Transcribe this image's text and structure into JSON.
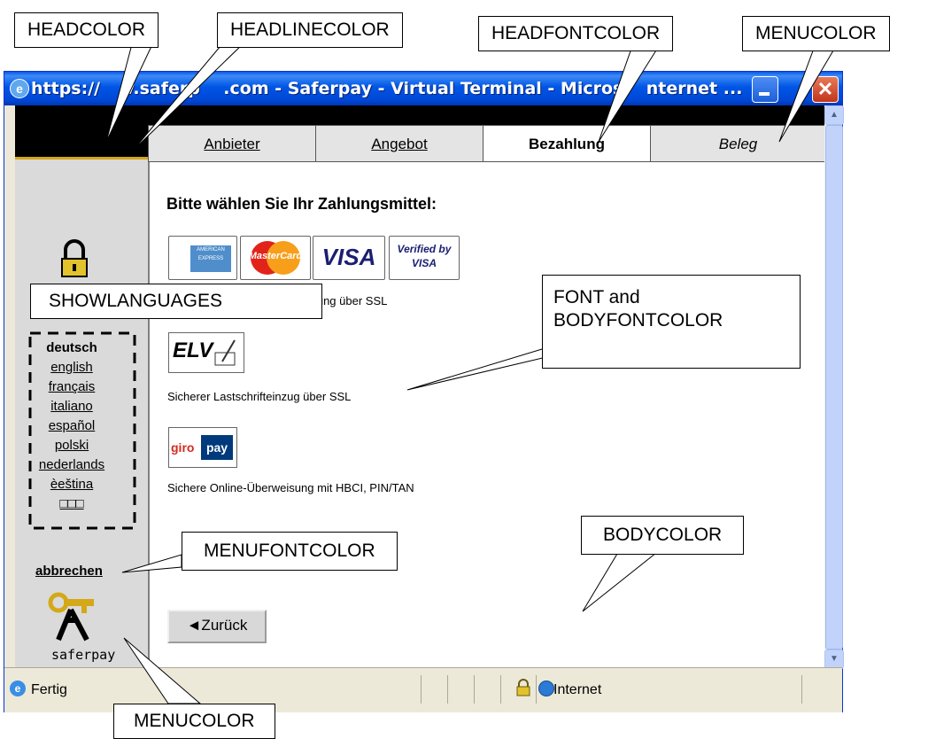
{
  "window": {
    "title": "https://www.saferpay.com - Saferpay - Virtual Terminal - Microsoft Internet ...",
    "title_visible": "https://    v.saferp    .com - Saferpay - Virtual Terminal - Micros    nternet ..."
  },
  "tabs": [
    {
      "label": "Anbieter",
      "state": "link"
    },
    {
      "label": "Angebot",
      "state": "link"
    },
    {
      "label": "Bezahlung",
      "state": "active"
    },
    {
      "label": "Beleg",
      "state": "disabled"
    }
  ],
  "content": {
    "heading": "Bitte wählen Sie Ihr Zahlungsmittel:",
    "card_logos": [
      "AMERICAN EXPRESS",
      "MasterCard",
      "VISA",
      "Verified by VISA"
    ],
    "card_caption": "zahlung über SSL",
    "elv_logo": "ELV",
    "elv_caption": "Sicherer Lastschrifteinzug über SSL",
    "giropay_logo": {
      "part1": "giro",
      "part2": "pay"
    },
    "giropay_caption": "Sichere Online-Überweisung mit HBCI, PIN/TAN",
    "back_label": "◄Zurück"
  },
  "menu": {
    "languages": [
      "deutsch",
      "english",
      "français",
      "italiano",
      "español",
      "polski",
      "nederlands",
      "èeština",
      "□□□"
    ],
    "cancel": "abbrechen",
    "logo_text": "saferpay"
  },
  "statusbar": {
    "status": "Fertig",
    "zone": "Internet"
  },
  "callouts": {
    "headcolor": "HEADCOLOR",
    "headlinecolor": "HEADLINECOLOR",
    "headfontcolor": "HEADFONTCOLOR",
    "menucolor_top": "MENUCOLOR",
    "showlanguages": "SHOWLANGUAGES",
    "font": "FONT and",
    "bodyfontcolor": "BODYFONTCOLOR",
    "menufontcolor": "MENUFONTCOLOR",
    "bodycolor": "BODYCOLOR",
    "menucolor_bottom": "MENUCOLOR"
  },
  "colors": {
    "title_bar": "#0055e5",
    "head": "#000000",
    "headline": "#d4a817",
    "menu": "#dadada",
    "body": "#ffffff"
  }
}
